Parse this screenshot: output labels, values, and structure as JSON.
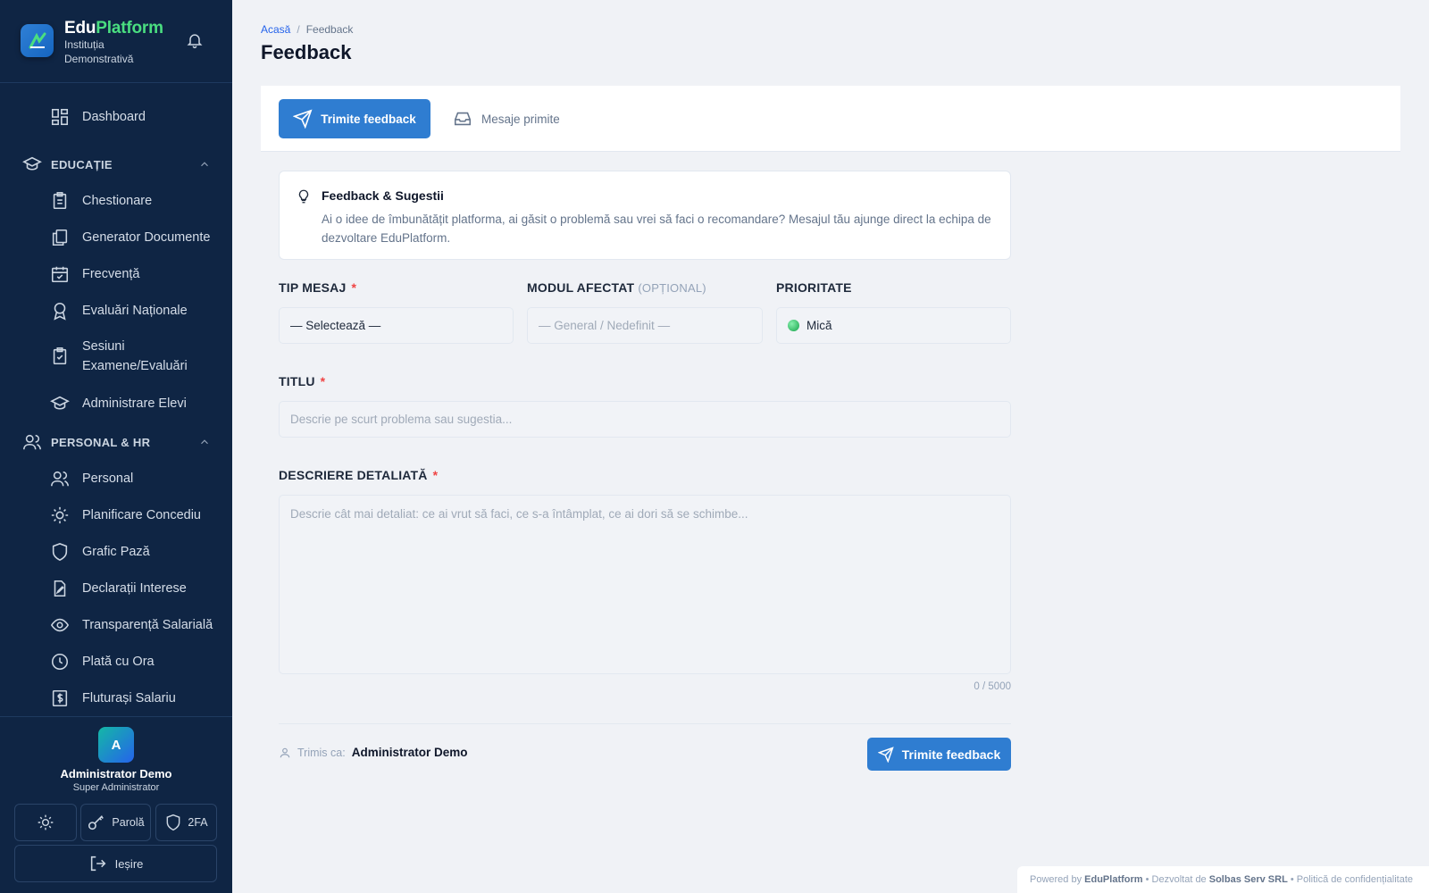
{
  "brand": {
    "name_part1": "Edu",
    "name_part2": "Platform",
    "subtitle": "Instituția Demonstrativă"
  },
  "sidebar": {
    "dashboard": "Dashboard",
    "sections": [
      {
        "label": "EDUCAȚIE",
        "items": [
          "Chestionare",
          "Generator Documente",
          "Frecvență",
          "Evaluări Naționale",
          "Sesiuni Examene/Evaluări",
          "Administrare Elevi"
        ]
      },
      {
        "label": "PERSONAL & HR",
        "items": [
          "Personal",
          "Planificare Concediu",
          "Grafic Pază",
          "Declarații Interese",
          "Transparență Salarială",
          "Plată cu Ora",
          "Fluturași Salariu"
        ]
      }
    ],
    "user": {
      "initial": "A",
      "name": "Administrator Demo",
      "role": "Super Administrator"
    },
    "buttons": {
      "password": "Parolă",
      "twofa": "2FA",
      "logout": "Ieșire"
    }
  },
  "breadcrumb": {
    "home": "Acasă",
    "separator": "/",
    "current": "Feedback"
  },
  "page": {
    "title": "Feedback"
  },
  "tabs": {
    "send": "Trimite feedback",
    "inbox": "Mesaje primite"
  },
  "info": {
    "title": "Feedback & Sugestii",
    "text": "Ai o idee de îmbunătățit platforma, ai găsit o problemă sau vrei să faci o recomandare? Mesajul tău ajunge direct la echipa de dezvoltare EduPlatform."
  },
  "form": {
    "type_label": "TIP MESAJ",
    "type_value": "— Selectează —",
    "module_label": "MODUL AFECTAT",
    "module_optional": "(OPȚIONAL)",
    "module_placeholder": "— General / Nedefinit —",
    "priority_label": "PRIORITATE",
    "priority_value": "Mică",
    "title_label": "TITLU",
    "title_placeholder": "Descrie pe scurt problema sau sugestia...",
    "desc_label": "DESCRIERE DETALIATĂ",
    "desc_placeholder": "Descrie cât mai detaliat: ce ai vrut să faci, ce s-a întâmplat, ce ai dori să se schimbe...",
    "counter": "0 / 5000",
    "required_mark": "*",
    "sent_as_label": "Trimis ca:",
    "sent_as_name": "Administrator Demo",
    "submit": "Trimite feedback"
  },
  "footer": {
    "powered": "Powered by",
    "brand": "EduPlatform",
    "dev": "• Dezvoltat de",
    "company": "Solbas Serv SRL",
    "privacy": "• Politică de confidențialitate"
  },
  "colors": {
    "sidebar_bg": "#0f2544",
    "accent": "#2f7dd1",
    "brand_green": "#4ade80",
    "required": "#ef4444"
  }
}
